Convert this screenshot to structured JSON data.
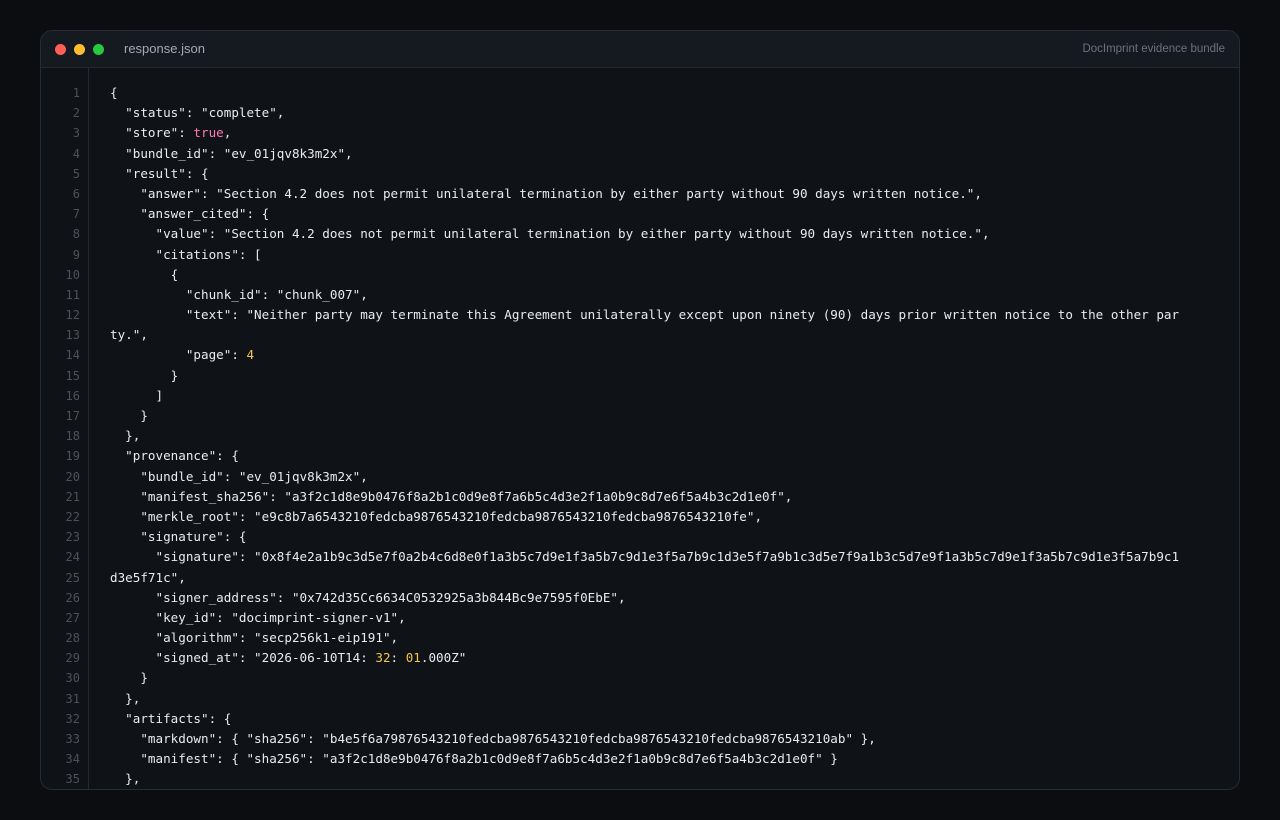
{
  "window": {
    "filename": "response.json",
    "bundle_label": "DocImprint evidence bundle"
  },
  "lines": [
    [
      {
        "t": "{"
      }
    ],
    [
      {
        "t": "  \"status\": \"complete\","
      }
    ],
    [
      {
        "t": "  \"store\": "
      },
      {
        "t": "true",
        "c": "bool"
      },
      {
        "t": ","
      }
    ],
    [
      {
        "t": "  \"bundle_id\": \"ev_01jqv8k3m2x\","
      }
    ],
    [
      {
        "t": "  \"result\": {"
      }
    ],
    [
      {
        "t": "    \"answer\": \"Section 4.2 does not permit unilateral termination by either party without 90 days written notice.\","
      }
    ],
    [
      {
        "t": "    \"answer_cited\": {"
      }
    ],
    [
      {
        "t": "      \"value\": \"Section 4.2 does not permit unilateral termination by either party without 90 days written notice.\","
      }
    ],
    [
      {
        "t": "      \"citations\": ["
      }
    ],
    [
      {
        "t": "        {"
      }
    ],
    [
      {
        "t": "          \"chunk_id\": \"chunk_007\","
      }
    ],
    [
      {
        "t": "          \"text\": \"Neither party may terminate this Agreement unilaterally except upon ninety (90) days prior written notice to the other par"
      }
    ],
    [
      {
        "t": "ty.\","
      }
    ],
    [
      {
        "t": "          \"page\": "
      },
      {
        "t": "4",
        "c": "num"
      }
    ],
    [
      {
        "t": "        }"
      }
    ],
    [
      {
        "t": "      ]"
      }
    ],
    [
      {
        "t": "    }"
      }
    ],
    [
      {
        "t": "  },"
      }
    ],
    [
      {
        "t": "  \"provenance\": {"
      }
    ],
    [
      {
        "t": "    \"bundle_id\": \"ev_01jqv8k3m2x\","
      }
    ],
    [
      {
        "t": "    \"manifest_sha256\": \"a3f2c1d8e9b0476f8a2b1c0d9e8f7a6b5c4d3e2f1a0b9c8d7e6f5a4b3c2d1e0f\","
      }
    ],
    [
      {
        "t": "    \"merkle_root\": \"e9c8b7a6543210fedcba9876543210fedcba9876543210fedcba9876543210fe\","
      }
    ],
    [
      {
        "t": "    \"signature\": {"
      }
    ],
    [
      {
        "t": "      \"signature\": \"0x8f4e2a1b9c3d5e7f0a2b4c6d8e0f1a3b5c7d9e1f3a5b7c9d1e3f5a7b9c1d3e5f7a9b1c3d5e7f9a1b3c5d7e9f1a3b5c7d9e1f3a5b7c9d1e3f5a7b9c1"
      }
    ],
    [
      {
        "t": "d3e5f71c\","
      }
    ],
    [
      {
        "t": "      \"signer_address\": \"0x742d35Cc6634C0532925a3b844Bc9e7595f0EbE\","
      }
    ],
    [
      {
        "t": "      \"key_id\": \"docimprint-signer-v1\","
      }
    ],
    [
      {
        "t": "      \"algorithm\": \"secp256k1-eip191\","
      }
    ],
    [
      {
        "t": "      \"signed_at\": \"2026-06-10T14: "
      },
      {
        "t": "32",
        "c": "num"
      },
      {
        "t": ": "
      },
      {
        "t": "01",
        "c": "num"
      },
      {
        "t": ".000Z\""
      }
    ],
    [
      {
        "t": "    }"
      }
    ],
    [
      {
        "t": "  },"
      }
    ],
    [
      {
        "t": "  \"artifacts\": {"
      }
    ],
    [
      {
        "t": "    \"markdown\": { \"sha256\": \"b4e5f6a79876543210fedcba9876543210fedcba9876543210fedcba9876543210ab\" },"
      }
    ],
    [
      {
        "t": "    \"manifest\": { \"sha256\": \"a3f2c1d8e9b0476f8a2b1c0d9e8f7a6b5c4d3e2f1a0b9c8d7e6f5a4b3c2d1e0f\" }"
      }
    ],
    [
      {
        "t": "  },"
      }
    ]
  ],
  "line_numbers": [
    "1",
    "2",
    "3",
    "4",
    "5",
    "6",
    "7",
    "8",
    "9",
    "10",
    "11",
    "12",
    "13",
    "14",
    "15",
    "16",
    "17",
    "18",
    "19",
    "20",
    "21",
    "22",
    "23",
    "24",
    "25",
    "26",
    "27",
    "28",
    "29",
    "30",
    "31",
    "32",
    "33",
    "34",
    "35"
  ],
  "colors": {
    "background": "#0b0d11",
    "panel": "#0f1217",
    "titlebar": "#151920",
    "text": "#e8ebf0",
    "boolean": "#ff7ab2",
    "number": "#f5c451",
    "line_number": "#4b525d"
  },
  "icons": [
    "close-dot",
    "minimize-dot",
    "maximize-dot"
  ]
}
